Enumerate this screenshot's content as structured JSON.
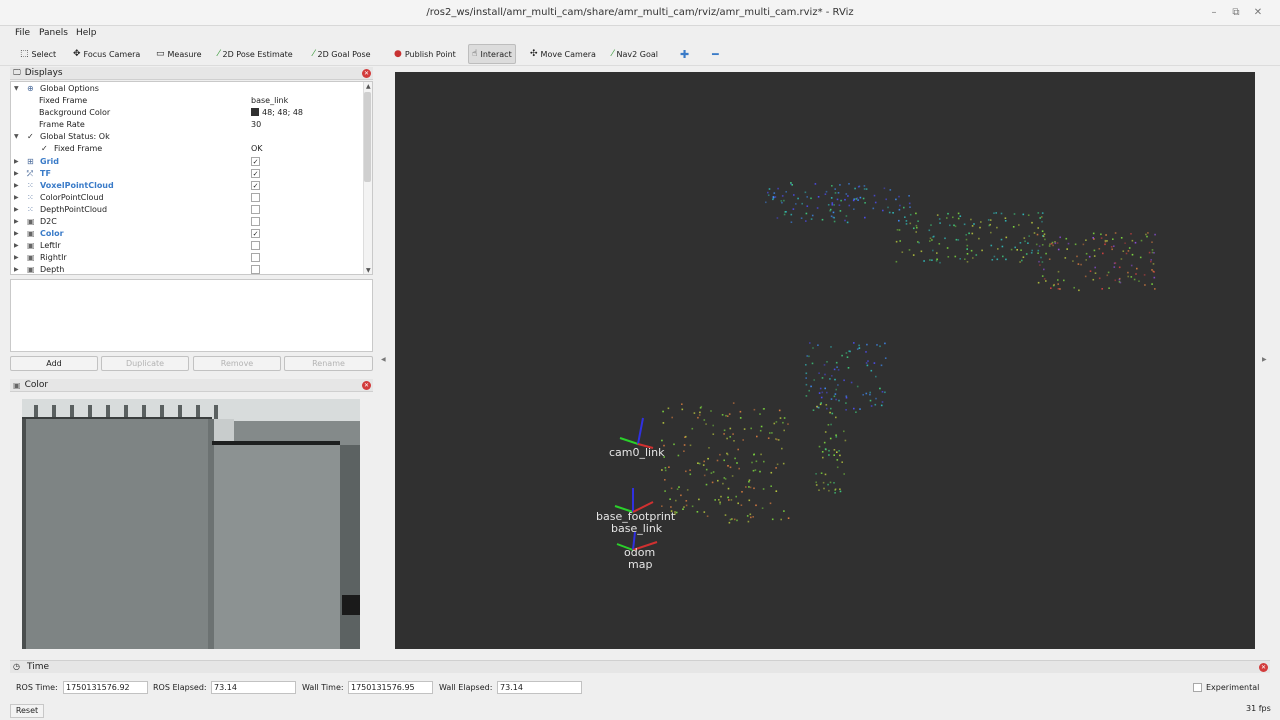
{
  "window": {
    "title": "/ros2_ws/install/amr_multi_cam/share/amr_multi_cam/rviz/amr_multi_cam.rviz* - RViz"
  },
  "menu": {
    "items": [
      "File",
      "Panels",
      "Help"
    ]
  },
  "toolbar": {
    "tools": [
      {
        "label": "Select",
        "icon": "select-icon"
      },
      {
        "label": "Focus Camera",
        "icon": "focus-camera-icon"
      },
      {
        "label": "Measure",
        "icon": "measure-icon"
      },
      {
        "label": "2D Pose Estimate",
        "icon": "pose-estimate-icon"
      },
      {
        "label": "2D Goal Pose",
        "icon": "goal-pose-icon"
      },
      {
        "label": "Publish Point",
        "icon": "publish-point-icon"
      },
      {
        "label": "Interact",
        "icon": "interact-icon"
      },
      {
        "label": "Move Camera",
        "icon": "move-camera-icon"
      },
      {
        "label": "Nav2 Goal",
        "icon": "nav2-goal-icon"
      }
    ],
    "active": "Interact"
  },
  "displays_panel": {
    "title": "Displays",
    "rows": [
      {
        "label": "Global Options",
        "value": ""
      },
      {
        "label": "Fixed Frame",
        "value": "base_link"
      },
      {
        "label": "Background Color",
        "value": "48; 48; 48"
      },
      {
        "label": "Frame Rate",
        "value": "30"
      },
      {
        "label": "Global Status: Ok",
        "value": ""
      },
      {
        "label": "Fixed Frame",
        "value": "OK"
      },
      {
        "label": "Grid",
        "checked": true
      },
      {
        "label": "TF",
        "checked": true
      },
      {
        "label": "VoxelPointCloud",
        "checked": true
      },
      {
        "label": "ColorPointCloud",
        "checked": false
      },
      {
        "label": "DepthPointCloud",
        "checked": false
      },
      {
        "label": "D2C",
        "checked": false
      },
      {
        "label": "Color",
        "checked": true
      },
      {
        "label": "LeftIr",
        "checked": false
      },
      {
        "label": "RightIr",
        "checked": false
      },
      {
        "label": "Depth",
        "checked": false
      }
    ],
    "buttons": {
      "add": "Add",
      "duplicate": "Duplicate",
      "remove": "Remove",
      "rename": "Rename"
    }
  },
  "image_panel": {
    "title": "Color"
  },
  "viewport": {
    "background": "#303030",
    "frame_labels": [
      "cam0_link",
      "base_footprint",
      "base_link",
      "odom",
      "map"
    ]
  },
  "time_panel": {
    "title": "Time",
    "ros_time_label": "ROS Time:",
    "ros_time": "1750131576.92",
    "ros_elapsed_label": "ROS Elapsed:",
    "ros_elapsed": "73.14",
    "wall_time_label": "Wall Time:",
    "wall_time": "1750131576.95",
    "wall_elapsed_label": "Wall Elapsed:",
    "wall_elapsed": "73.14",
    "experimental_label": "Experimental",
    "reset_label": "Reset",
    "fps": "31 fps"
  }
}
